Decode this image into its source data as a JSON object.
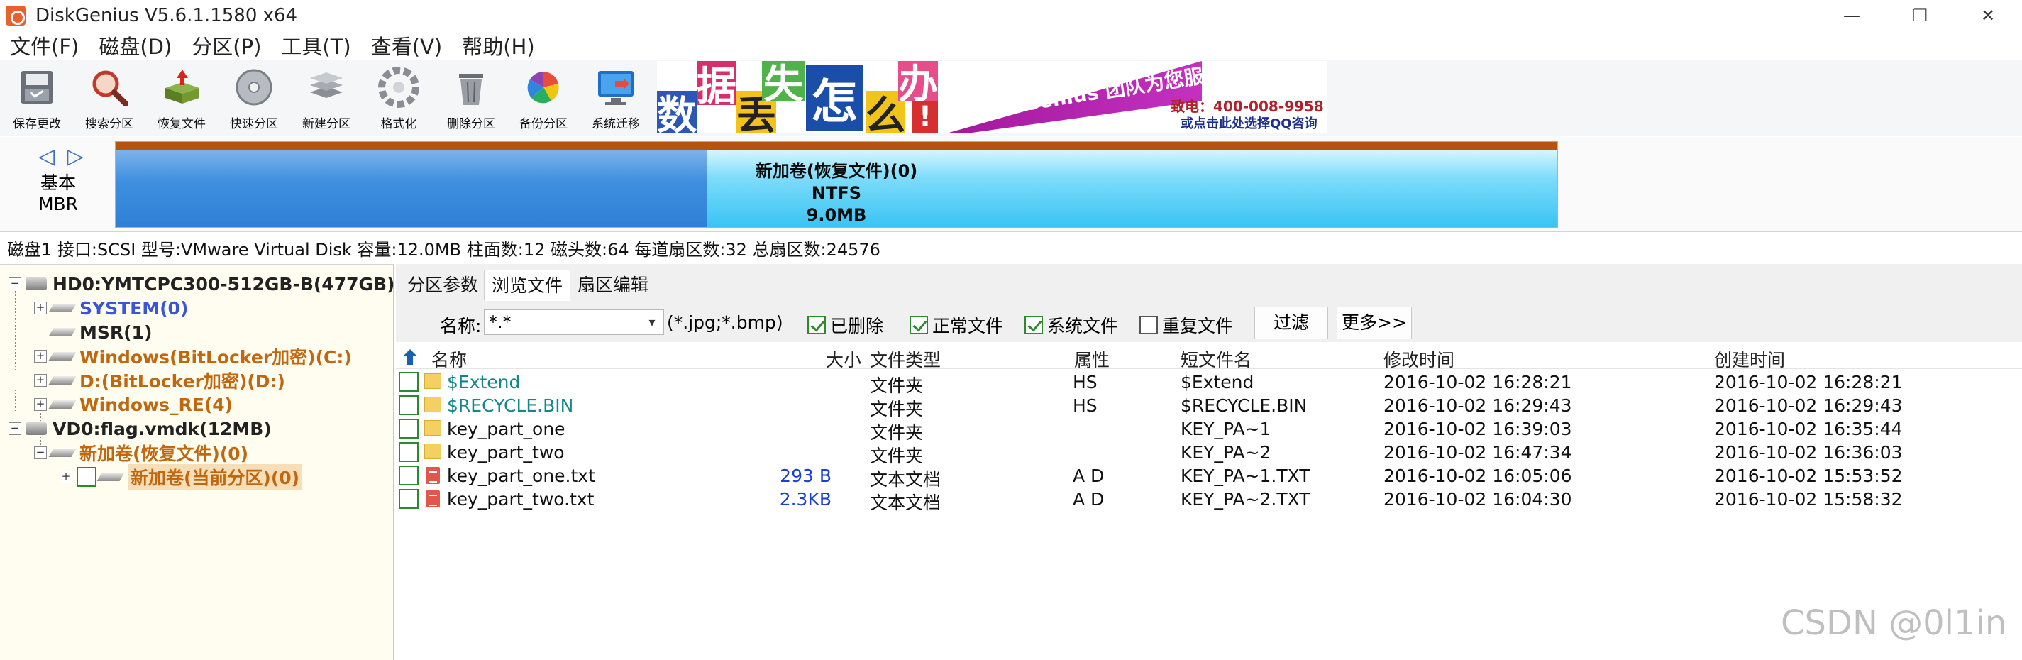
{
  "window": {
    "title": "DiskGenius V5.6.1.1580 x64",
    "controls": [
      "—",
      "❐",
      "✕"
    ]
  },
  "menu": [
    "文件(F)",
    "磁盘(D)",
    "分区(P)",
    "工具(T)",
    "查看(V)",
    "帮助(H)"
  ],
  "toolbar": [
    {
      "label": "保存更改",
      "icon": "save-icon"
    },
    {
      "label": "搜索分区",
      "icon": "search-partition-icon"
    },
    {
      "label": "恢复文件",
      "icon": "recover-files-icon"
    },
    {
      "label": "快速分区",
      "icon": "quick-partition-icon"
    },
    {
      "label": "新建分区",
      "icon": "new-partition-icon"
    },
    {
      "label": "格式化",
      "icon": "format-icon"
    },
    {
      "label": "删除分区",
      "icon": "delete-partition-icon"
    },
    {
      "label": "备份分区",
      "icon": "backup-partition-icon"
    },
    {
      "label": "系统迁移",
      "icon": "system-migration-icon"
    }
  ],
  "ad": {
    "tiles": [
      "数",
      "据",
      "丢",
      "失",
      "怎",
      "么",
      "办",
      "!"
    ],
    "slogan": "DiskGenius 团队为您服务",
    "phone": "致电：400-008-9958",
    "qq": "或点击此处选择QQ咨询",
    "colors": {
      "ribbon": "#b423b0"
    }
  },
  "diskmap": {
    "arrows": "◁ ▷",
    "disk_type_line1": "基本",
    "disk_type_line2": "MBR",
    "partition_name": "新加卷(恢复文件)(0)",
    "partition_fs": "NTFS",
    "partition_size": "9.0MB",
    "used_fraction": 0.41
  },
  "disk_info": "磁盘1 接口:SCSI  型号:VMware Virtual Disk  容量:12.0MB  柱面数:12  磁头数:64  每道扇区数:32  总扇区数:24576",
  "tree": {
    "hd0": "HD0:YMTCPC300-512GB-B(477GB)",
    "system": "SYSTEM(0)",
    "msr": "MSR(1)",
    "windows": "Windows(BitLocker加密)(C:)",
    "d": "D:(BitLocker加密)(D:)",
    "winre": "Windows_RE(4)",
    "vd0": "VD0:flag.vmdk(12MB)",
    "newvol": "新加卷(恢复文件)(0)",
    "current": "新加卷(当前分区)(0)",
    "toggle_plus": "+",
    "toggle_minus": "−"
  },
  "tabs": [
    "分区参数",
    "浏览文件",
    "扇区编辑"
  ],
  "active_tab": 1,
  "filter": {
    "name_label": "名称:",
    "name_value": "*.*",
    "hint": "(*.jpg;*.bmp)",
    "deleted": {
      "label": "已删除",
      "checked": true
    },
    "normal": {
      "label": "正常文件",
      "checked": true
    },
    "system": {
      "label": "系统文件",
      "checked": true
    },
    "duplicate": {
      "label": "重复文件",
      "checked": false
    },
    "filter_btn": "过滤",
    "more_btn": "更多>>"
  },
  "columns": {
    "name": "名称",
    "size": "大小",
    "type": "文件类型",
    "attr": "属性",
    "short": "短文件名",
    "modified": "修改时间",
    "created": "创建时间"
  },
  "files": [
    {
      "name": "$Extend",
      "size": "",
      "type": "文件夹",
      "attr": "HS",
      "short": "$Extend",
      "modified": "2016-10-02 16:28:21",
      "created": "2016-10-02 16:28:21"
    },
    {
      "name": "$RECYCLE.BIN",
      "size": "",
      "type": "文件夹",
      "attr": "HS",
      "short": "$RECYCLE.BIN",
      "modified": "2016-10-02 16:29:43",
      "created": "2016-10-02 16:29:43"
    },
    {
      "name": "key_part_one",
      "size": "",
      "type": "文件夹",
      "attr": "",
      "short": "KEY_PA~1",
      "modified": "2016-10-02 16:39:03",
      "created": "2016-10-02 16:35:44"
    },
    {
      "name": "key_part_two",
      "size": "",
      "type": "文件夹",
      "attr": "",
      "short": "KEY_PA~2",
      "modified": "2016-10-02 16:47:34",
      "created": "2016-10-02 16:36:03"
    },
    {
      "name": "key_part_one.txt",
      "size": "293 B",
      "type": "文本文档",
      "attr": "A D",
      "short": "KEY_PA~1.TXT",
      "modified": "2016-10-02 16:05:06",
      "created": "2016-10-02 15:53:52"
    },
    {
      "name": "key_part_two.txt",
      "size": "2.3KB",
      "type": "文本文档",
      "attr": "A D",
      "short": "KEY_PA~2.TXT",
      "modified": "2016-10-02 16:04:30",
      "created": "2016-10-02 15:58:32"
    }
  ],
  "watermark": "CSDN @0l1in"
}
